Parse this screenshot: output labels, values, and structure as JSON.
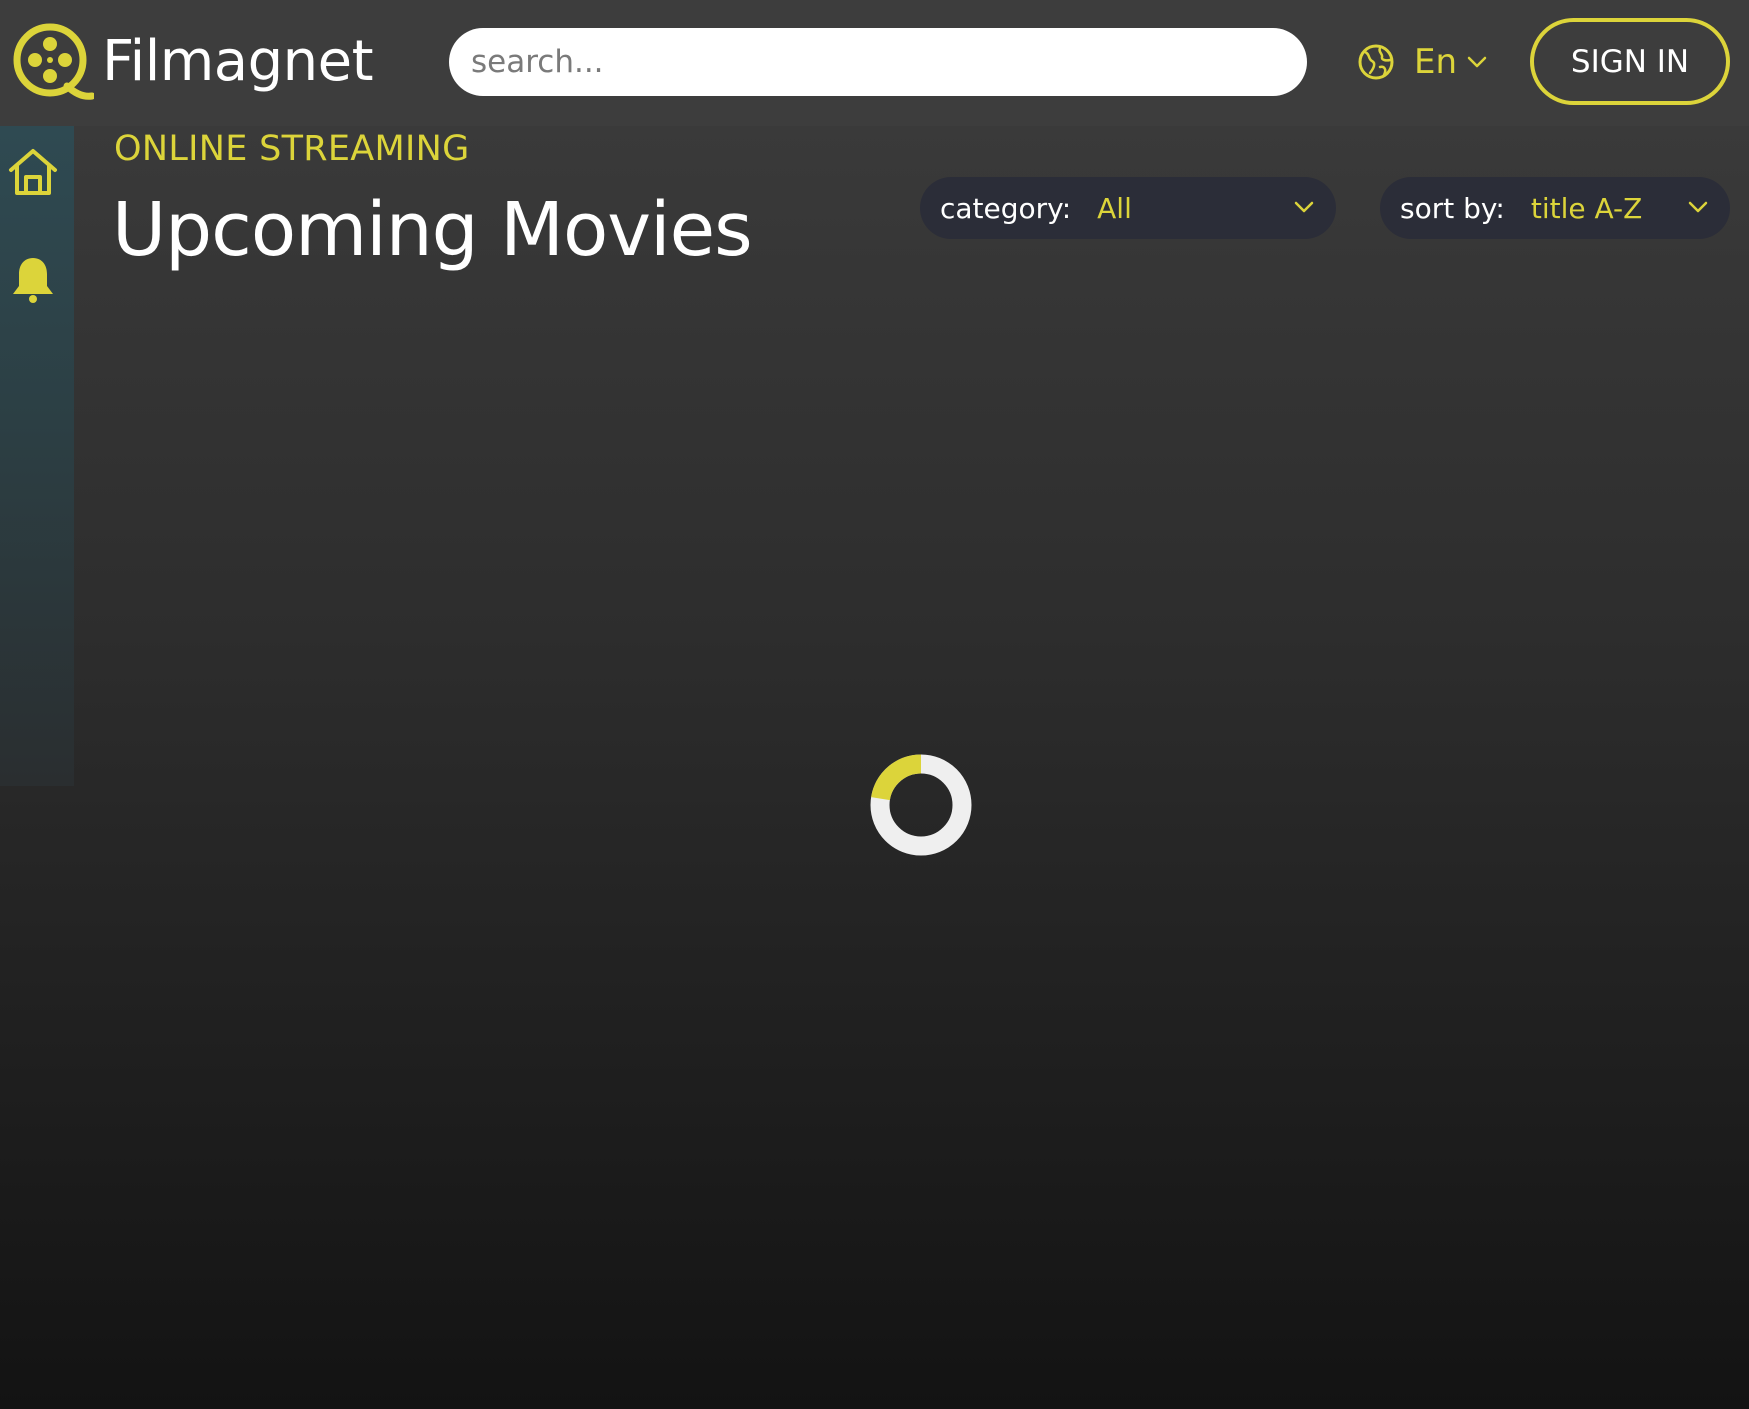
{
  "app": {
    "name": "Filmagnet",
    "accent_color": "#dcd43a",
    "background_color": "#3d3d3d"
  },
  "header": {
    "logo_icon": "film-reel-icon",
    "search": {
      "placeholder": "search...",
      "value": ""
    },
    "language": {
      "icon": "globe-icon",
      "label": "En"
    },
    "signin_label": "SIGN IN"
  },
  "sidebar": {
    "items": [
      {
        "icon": "home-icon",
        "active": true
      },
      {
        "icon": "bell-icon",
        "active": false
      }
    ]
  },
  "main": {
    "eyebrow": "ONLINE STREAMING",
    "title": "Upcoming Movies",
    "filters": {
      "category": {
        "label": "category:",
        "value": "All"
      },
      "sort": {
        "label": "sort by:",
        "value": "title A-Z"
      }
    },
    "loading": true
  }
}
